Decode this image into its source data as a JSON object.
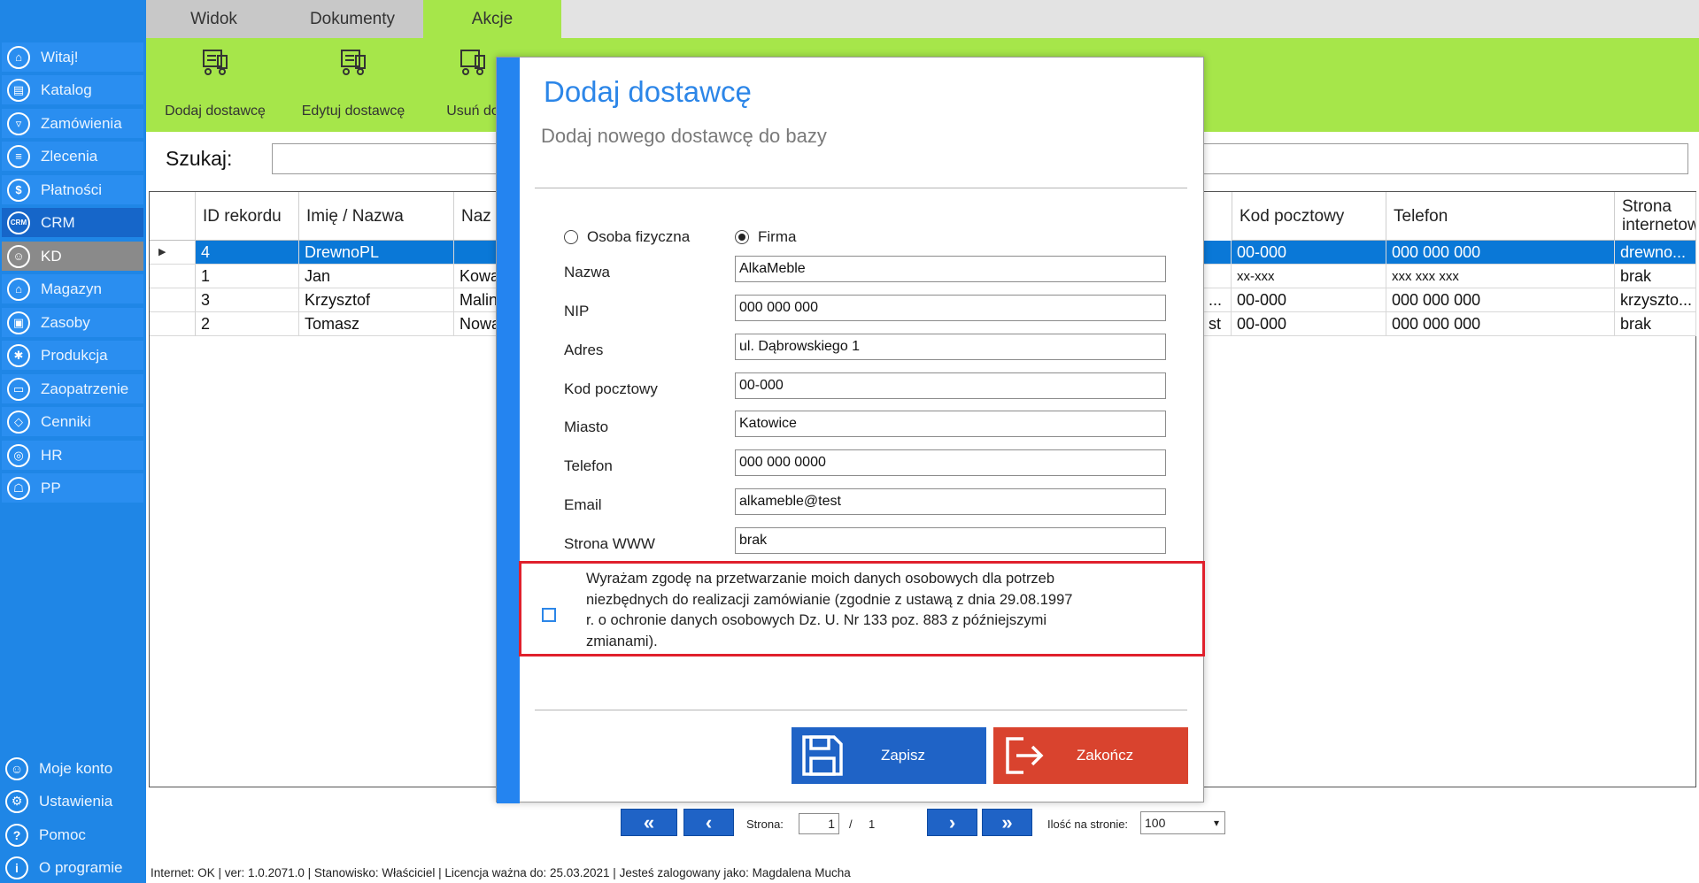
{
  "sidebar": {
    "items": [
      {
        "label": "Witaj!",
        "icon": "home-icon"
      },
      {
        "label": "Katalog",
        "icon": "book-icon"
      },
      {
        "label": "Zamówienia",
        "icon": "cart-icon"
      },
      {
        "label": "Zlecenia",
        "icon": "list-icon"
      },
      {
        "label": "Płatności",
        "icon": "dollar-icon"
      },
      {
        "label": "CRM",
        "icon": "crm-icon"
      },
      {
        "label": "KD",
        "icon": "user-icon"
      },
      {
        "label": "Magazyn",
        "icon": "warehouse-icon"
      },
      {
        "label": "Zasoby",
        "icon": "box-icon"
      },
      {
        "label": "Produkcja",
        "icon": "production-icon"
      },
      {
        "label": "Zaopatrzenie",
        "icon": "truck-icon"
      },
      {
        "label": "Cenniki",
        "icon": "tag-icon"
      },
      {
        "label": "HR",
        "icon": "hr-icon"
      },
      {
        "label": "PP",
        "icon": "pp-icon"
      }
    ],
    "bottom": [
      {
        "label": "Moje konto",
        "icon": "account-icon"
      },
      {
        "label": "Ustawienia",
        "icon": "gear-icon"
      },
      {
        "label": "Pomoc",
        "icon": "help-icon"
      },
      {
        "label": "O programie",
        "icon": "info-icon"
      }
    ]
  },
  "tabs": {
    "widok": "Widok",
    "dokumenty": "Dokumenty",
    "akcje": "Akcje"
  },
  "ribbon": {
    "add": "Dodaj dostawcę",
    "edit": "Edytuj dostawcę",
    "delete": "Usuń do"
  },
  "search": {
    "label": "Szukaj:",
    "value": ""
  },
  "table": {
    "headers": {
      "id": "ID rekordu",
      "name": "Imię / Nazwa",
      "surname": "Naz",
      "zip": "Kod pocztowy",
      "phone": "Telefon",
      "www": "Strona internetow"
    },
    "rows": [
      {
        "id": "4",
        "name": "DrewnoPL",
        "surname": "",
        "extra": "",
        "zip": "00-000",
        "phone": "000 000 000",
        "www": "drewno..."
      },
      {
        "id": "1",
        "name": "Jan",
        "surname": "Kowa",
        "extra": "",
        "zip": "xx-xxx",
        "phone": "xxx xxx xxx",
        "www": "brak"
      },
      {
        "id": "3",
        "name": "Krzysztof",
        "surname": "Malin",
        "extra": "...",
        "zip": "00-000",
        "phone": "000 000 000",
        "www": "krzyszto..."
      },
      {
        "id": "2",
        "name": "Tomasz",
        "surname": "Nowa",
        "extra": "st",
        "zip": "00-000",
        "phone": "000 000 000",
        "www": "brak"
      }
    ]
  },
  "modal": {
    "title": "Dodaj dostawcę",
    "subtitle": "Dodaj nowego dostawcę do bazy",
    "radio_person": "Osoba fizyczna",
    "radio_company": "Firma",
    "fields": {
      "nazwa": {
        "label": "Nazwa",
        "value": "AlkaMeble"
      },
      "nip": {
        "label": "NIP",
        "value": "000 000 000"
      },
      "adres": {
        "label": "Adres",
        "value": "ul. Dąbrowskiego 1"
      },
      "kod": {
        "label": "Kod pocztowy",
        "value": "00-000"
      },
      "miasto": {
        "label": "Miasto",
        "value": "Katowice"
      },
      "telefon": {
        "label": "Telefon",
        "value": "000 000 0000"
      },
      "email": {
        "label": "Email",
        "value": "alkameble@test"
      },
      "www": {
        "label": "Strona WWW",
        "value": "brak"
      }
    },
    "consent": "Wyrażam zgodę na przetwarzanie moich danych osobowych dla potrzeb niezbędnych do realizacji zamówianie (zgodnie z ustawą z dnia 29.08.1997 r. o ochronie danych osobowych Dz. U. Nr 133 poz. 883 z późniejszymi zmianami).",
    "save": "Zapisz",
    "close": "Zakończ"
  },
  "pager": {
    "first": "«",
    "prev": "‹",
    "next": "›",
    "last": "»",
    "page_label": "Strona:",
    "page": "1",
    "sep": "/",
    "total": "1",
    "per_page_label": "Ilość na stronie:",
    "per_page": "100"
  },
  "status": "Internet: OK  |   ver: 1.0.2071.0   |   Stanowisko: Właściciel    |   Licencja ważna do: 25.03.2021   |   Jesteś zalogowany jako: Magdalena Mucha",
  "colors": {
    "sidebar": "#1f86e6",
    "ribbon": "#a6e64a",
    "selection": "#0a78d7",
    "accent": "#2c86e8",
    "save": "#1f63c6",
    "close": "#d9432e",
    "highlight": "#e0202c"
  }
}
